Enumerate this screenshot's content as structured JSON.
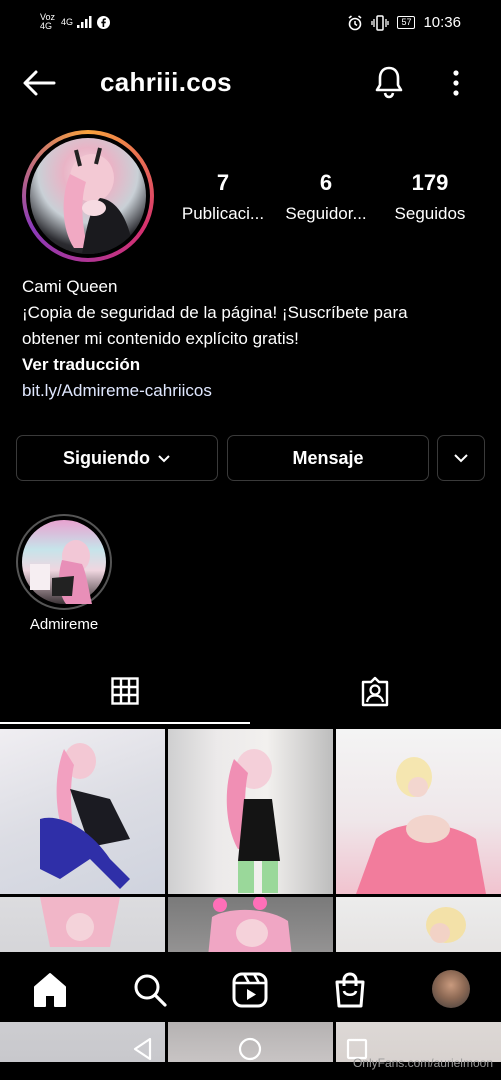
{
  "status_bar": {
    "carrier_top": "Voz",
    "carrier_bottom": "4G",
    "net": "4G",
    "battery": "57",
    "time": "10:36"
  },
  "header": {
    "title": "cahriii.cos"
  },
  "profile": {
    "stats": [
      {
        "value": "7",
        "label": "Publicaci..."
      },
      {
        "value": "6",
        "label": "Seguidor..."
      },
      {
        "value": "179",
        "label": "Seguidos"
      }
    ],
    "name": "Cami Queen",
    "bio_line1": "¡Copia de seguridad de la página! ¡Suscríbete para",
    "bio_line2": "obtener mi contenido explícito gratis!",
    "translate": "Ver traducción",
    "link": "bit.ly/Admireme-cahriicos"
  },
  "actions": {
    "following": "Siguiendo",
    "message": "Mensaje"
  },
  "highlight": {
    "label": "Admireme"
  },
  "watermark": "OnlyFans.com/aurielmoon"
}
